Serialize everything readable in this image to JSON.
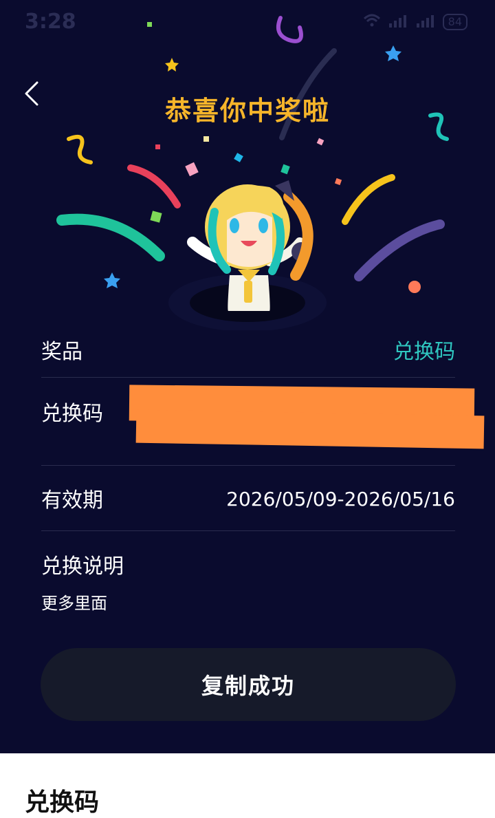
{
  "status_bar": {
    "time": "3:28",
    "battery": "84"
  },
  "header": {
    "title": "恭喜你中奖啦"
  },
  "prize": {
    "label": "奖品",
    "value": "兑换码"
  },
  "code": {
    "label": "兑换码"
  },
  "validity": {
    "label": "有效期",
    "value": "2026/05/09-2026/05/16"
  },
  "instructions": {
    "label": "兑换说明",
    "text": "更多里面"
  },
  "actions": {
    "copy_label": "复制成功"
  },
  "sheet": {
    "title": "兑换码"
  },
  "colors": {
    "background": "#0a0b2e",
    "title": "#f6b52a",
    "accent": "#2fc7c0",
    "redaction": "#ff8d3c",
    "button": "#161a2a"
  }
}
